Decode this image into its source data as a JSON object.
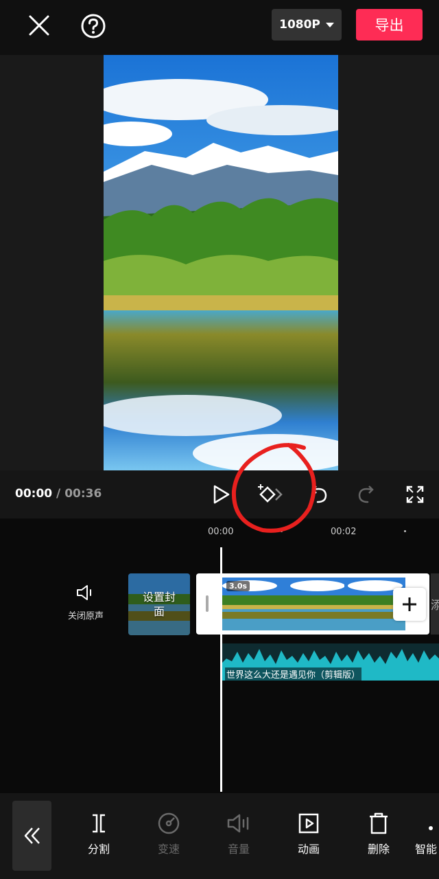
{
  "header": {
    "resolution": "1080P",
    "export_label": "导出",
    "close_icon": "close-icon",
    "help_icon": "help-icon"
  },
  "player": {
    "current_time": "00:00",
    "separator": "/",
    "total_time": "00:36"
  },
  "ruler": {
    "labels": [
      "00:00",
      "00:02"
    ]
  },
  "track": {
    "mute_label": "关闭原声",
    "cover_label": "设置封面",
    "clip_duration": "3.0s",
    "add_partial": "添",
    "audio_title": "世界这么大还是遇见你（剪辑版）"
  },
  "toolbar": {
    "items": [
      {
        "label": "分割",
        "icon": "split-icon",
        "enabled": true
      },
      {
        "label": "变速",
        "icon": "speed-icon",
        "enabled": false
      },
      {
        "label": "音量",
        "icon": "volume-icon",
        "enabled": false
      },
      {
        "label": "动画",
        "icon": "animation-icon",
        "enabled": true
      },
      {
        "label": "删除",
        "icon": "delete-icon",
        "enabled": true
      },
      {
        "label": "智能",
        "icon": "smart-icon",
        "enabled": true
      }
    ]
  },
  "colors": {
    "accent": "#fe2c55",
    "annotation": "#e8201e",
    "audio_wave": "#1fb9c6"
  }
}
